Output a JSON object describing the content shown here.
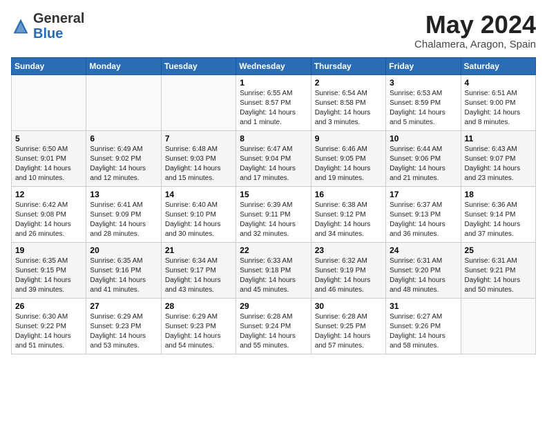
{
  "header": {
    "logo_general": "General",
    "logo_blue": "Blue",
    "month_title": "May 2024",
    "location": "Chalamera, Aragon, Spain"
  },
  "days_of_week": [
    "Sunday",
    "Monday",
    "Tuesday",
    "Wednesday",
    "Thursday",
    "Friday",
    "Saturday"
  ],
  "weeks": [
    [
      {
        "day": "",
        "content": ""
      },
      {
        "day": "",
        "content": ""
      },
      {
        "day": "",
        "content": ""
      },
      {
        "day": "1",
        "content": "Sunrise: 6:55 AM\nSunset: 8:57 PM\nDaylight: 14 hours\nand 1 minute."
      },
      {
        "day": "2",
        "content": "Sunrise: 6:54 AM\nSunset: 8:58 PM\nDaylight: 14 hours\nand 3 minutes."
      },
      {
        "day": "3",
        "content": "Sunrise: 6:53 AM\nSunset: 8:59 PM\nDaylight: 14 hours\nand 5 minutes."
      },
      {
        "day": "4",
        "content": "Sunrise: 6:51 AM\nSunset: 9:00 PM\nDaylight: 14 hours\nand 8 minutes."
      }
    ],
    [
      {
        "day": "5",
        "content": "Sunrise: 6:50 AM\nSunset: 9:01 PM\nDaylight: 14 hours\nand 10 minutes."
      },
      {
        "day": "6",
        "content": "Sunrise: 6:49 AM\nSunset: 9:02 PM\nDaylight: 14 hours\nand 12 minutes."
      },
      {
        "day": "7",
        "content": "Sunrise: 6:48 AM\nSunset: 9:03 PM\nDaylight: 14 hours\nand 15 minutes."
      },
      {
        "day": "8",
        "content": "Sunrise: 6:47 AM\nSunset: 9:04 PM\nDaylight: 14 hours\nand 17 minutes."
      },
      {
        "day": "9",
        "content": "Sunrise: 6:46 AM\nSunset: 9:05 PM\nDaylight: 14 hours\nand 19 minutes."
      },
      {
        "day": "10",
        "content": "Sunrise: 6:44 AM\nSunset: 9:06 PM\nDaylight: 14 hours\nand 21 minutes."
      },
      {
        "day": "11",
        "content": "Sunrise: 6:43 AM\nSunset: 9:07 PM\nDaylight: 14 hours\nand 23 minutes."
      }
    ],
    [
      {
        "day": "12",
        "content": "Sunrise: 6:42 AM\nSunset: 9:08 PM\nDaylight: 14 hours\nand 26 minutes."
      },
      {
        "day": "13",
        "content": "Sunrise: 6:41 AM\nSunset: 9:09 PM\nDaylight: 14 hours\nand 28 minutes."
      },
      {
        "day": "14",
        "content": "Sunrise: 6:40 AM\nSunset: 9:10 PM\nDaylight: 14 hours\nand 30 minutes."
      },
      {
        "day": "15",
        "content": "Sunrise: 6:39 AM\nSunset: 9:11 PM\nDaylight: 14 hours\nand 32 minutes."
      },
      {
        "day": "16",
        "content": "Sunrise: 6:38 AM\nSunset: 9:12 PM\nDaylight: 14 hours\nand 34 minutes."
      },
      {
        "day": "17",
        "content": "Sunrise: 6:37 AM\nSunset: 9:13 PM\nDaylight: 14 hours\nand 36 minutes."
      },
      {
        "day": "18",
        "content": "Sunrise: 6:36 AM\nSunset: 9:14 PM\nDaylight: 14 hours\nand 37 minutes."
      }
    ],
    [
      {
        "day": "19",
        "content": "Sunrise: 6:35 AM\nSunset: 9:15 PM\nDaylight: 14 hours\nand 39 minutes."
      },
      {
        "day": "20",
        "content": "Sunrise: 6:35 AM\nSunset: 9:16 PM\nDaylight: 14 hours\nand 41 minutes."
      },
      {
        "day": "21",
        "content": "Sunrise: 6:34 AM\nSunset: 9:17 PM\nDaylight: 14 hours\nand 43 minutes."
      },
      {
        "day": "22",
        "content": "Sunrise: 6:33 AM\nSunset: 9:18 PM\nDaylight: 14 hours\nand 45 minutes."
      },
      {
        "day": "23",
        "content": "Sunrise: 6:32 AM\nSunset: 9:19 PM\nDaylight: 14 hours\nand 46 minutes."
      },
      {
        "day": "24",
        "content": "Sunrise: 6:31 AM\nSunset: 9:20 PM\nDaylight: 14 hours\nand 48 minutes."
      },
      {
        "day": "25",
        "content": "Sunrise: 6:31 AM\nSunset: 9:21 PM\nDaylight: 14 hours\nand 50 minutes."
      }
    ],
    [
      {
        "day": "26",
        "content": "Sunrise: 6:30 AM\nSunset: 9:22 PM\nDaylight: 14 hours\nand 51 minutes."
      },
      {
        "day": "27",
        "content": "Sunrise: 6:29 AM\nSunset: 9:23 PM\nDaylight: 14 hours\nand 53 minutes."
      },
      {
        "day": "28",
        "content": "Sunrise: 6:29 AM\nSunset: 9:23 PM\nDaylight: 14 hours\nand 54 minutes."
      },
      {
        "day": "29",
        "content": "Sunrise: 6:28 AM\nSunset: 9:24 PM\nDaylight: 14 hours\nand 55 minutes."
      },
      {
        "day": "30",
        "content": "Sunrise: 6:28 AM\nSunset: 9:25 PM\nDaylight: 14 hours\nand 57 minutes."
      },
      {
        "day": "31",
        "content": "Sunrise: 6:27 AM\nSunset: 9:26 PM\nDaylight: 14 hours\nand 58 minutes."
      },
      {
        "day": "",
        "content": ""
      }
    ]
  ]
}
